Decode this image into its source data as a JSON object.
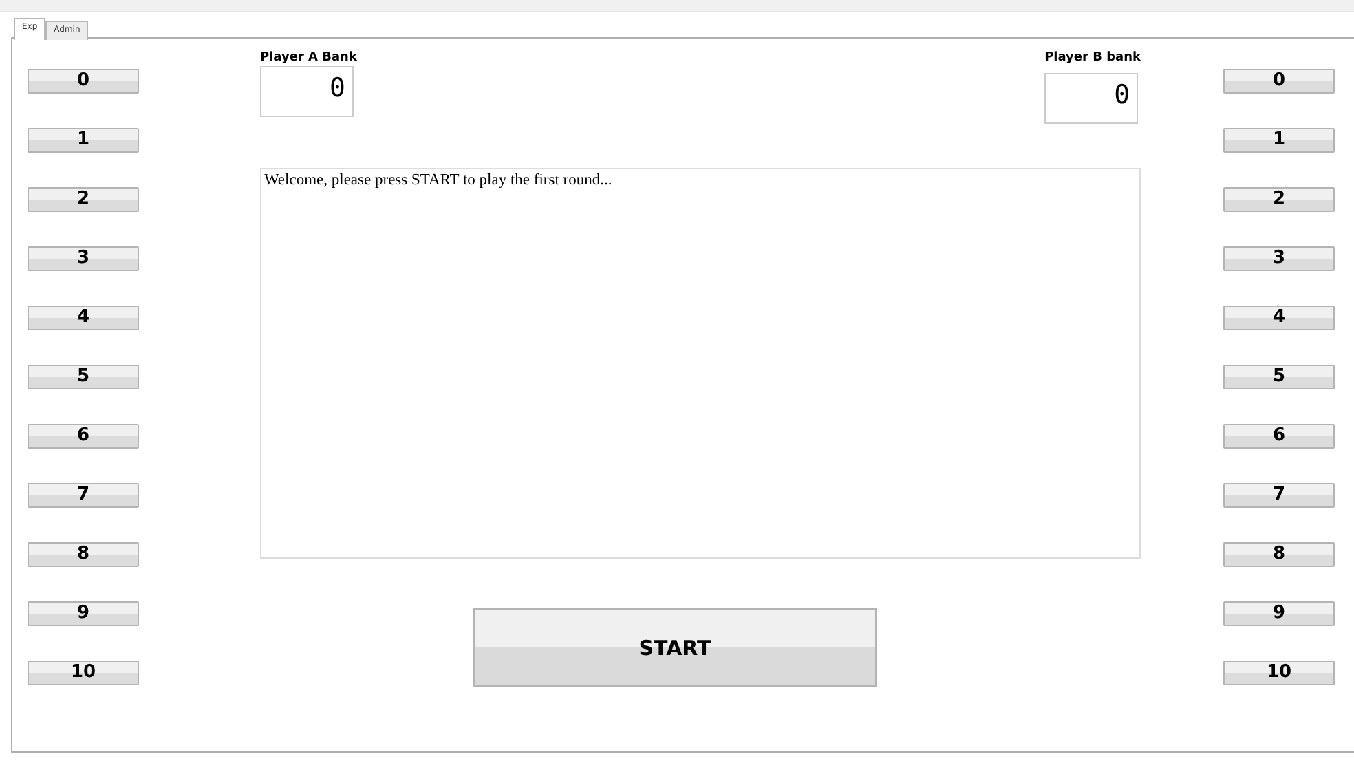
{
  "tabs": [
    {
      "label": "Exp",
      "selected": true
    },
    {
      "label": "Admin",
      "selected": false
    }
  ],
  "player_a": {
    "label": "Player A Bank",
    "value": "0"
  },
  "player_b": {
    "label": "Player B bank",
    "value": "0"
  },
  "left_buttons": [
    "0",
    "1",
    "2",
    "3",
    "4",
    "5",
    "6",
    "7",
    "8",
    "9",
    "10"
  ],
  "right_buttons": [
    "0",
    "1",
    "2",
    "3",
    "4",
    "5",
    "6",
    "7",
    "8",
    "9",
    "10"
  ],
  "message": "Welcome, please press START to play the first round...",
  "start_button": "START"
}
